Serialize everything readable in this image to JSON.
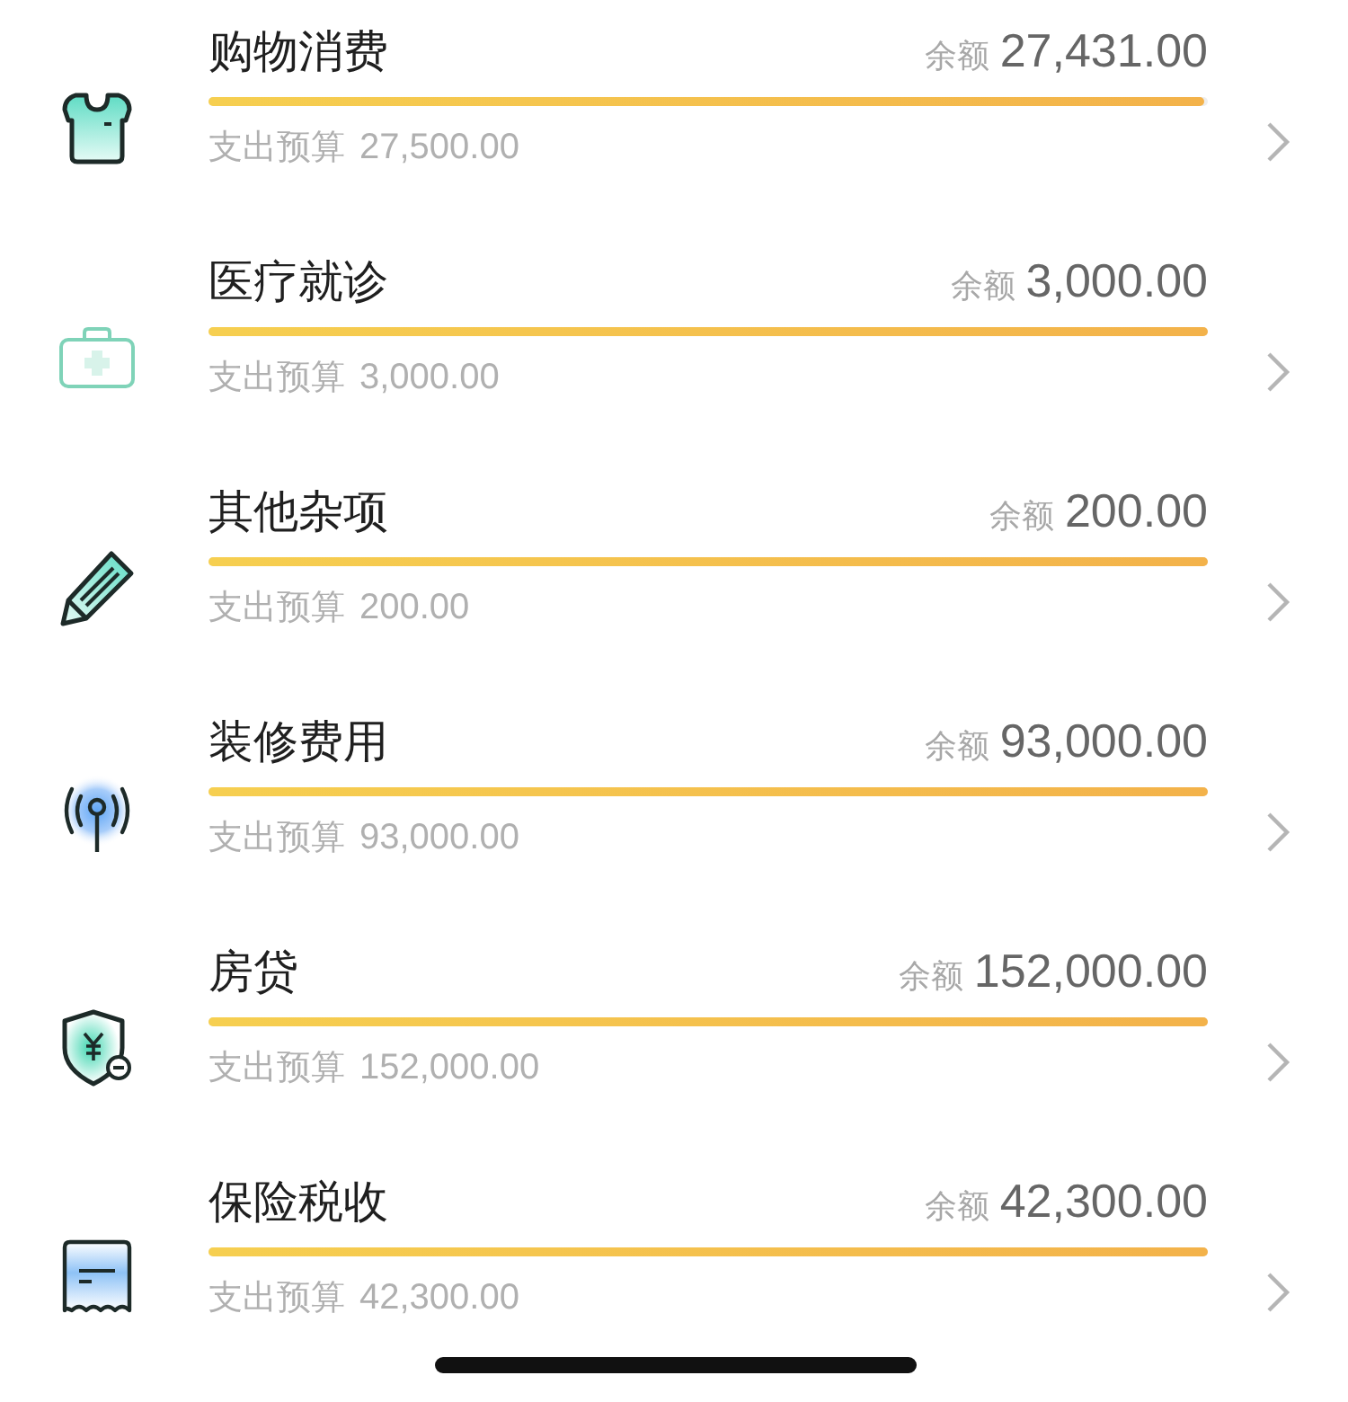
{
  "categories": [
    {
      "name": "购物消费",
      "balance_label": "余额",
      "balance": "27,431.00",
      "budget_label": "支出预算",
      "budget": "27,500.00",
      "level": 0.997
    },
    {
      "name": "医疗就诊",
      "balance_label": "余额",
      "balance": "3,000.00",
      "budget_label": "支出预算",
      "budget": "3,000.00",
      "level": 1
    },
    {
      "name": "其他杂项",
      "balance_label": "余额",
      "balance": "200.00",
      "budget_label": "支出预算",
      "budget": "200.00",
      "level": 1
    },
    {
      "name": "装修费用",
      "balance_label": "余额",
      "balance": "93,000.00",
      "budget_label": "支出预算",
      "budget": "93,000.00",
      "level": 1
    },
    {
      "name": "房贷",
      "balance_label": "余额",
      "balance": "152,000.00",
      "budget_label": "支出预算",
      "budget": "152,000.00",
      "level": 1
    },
    {
      "name": "保险税收",
      "balance_label": "余额",
      "balance": "42,300.00",
      "budget_label": "支出预算",
      "budget": "42,300.00",
      "level": 1
    }
  ]
}
